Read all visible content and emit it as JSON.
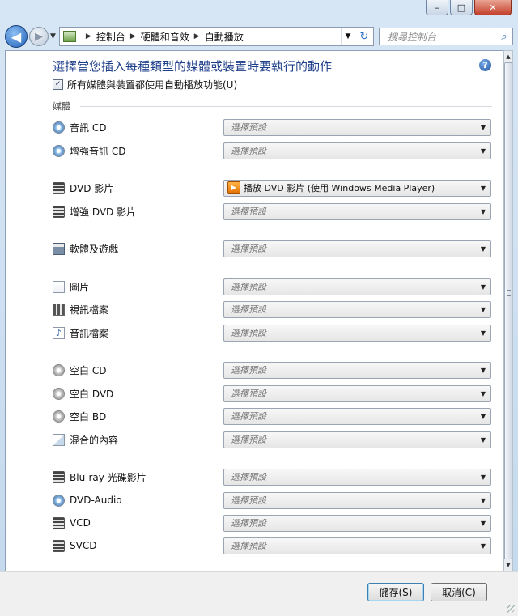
{
  "window": {
    "minimize": "–",
    "maximize": "□",
    "close": "✕"
  },
  "nav": {
    "back_icon": "arrow-left-icon",
    "forward_icon": "arrow-right-icon",
    "breadcrumb": [
      "控制台",
      "硬體和音效",
      "自動播放"
    ],
    "search_placeholder": "搜尋控制台"
  },
  "main": {
    "title": "選擇當您插入每種類型的媒體或裝置時要執行的動作",
    "help": "?",
    "autoplay_label": "所有媒體與裝置都使用自動播放功能(U)",
    "autoplay_checked": true,
    "section_media": "媒體",
    "items": [
      {
        "label": "音訊 CD",
        "icon": "disc-icon",
        "value": "選擇預設"
      },
      {
        "label": "增強音訊 CD",
        "icon": "disc-icon",
        "value": "選擇預設"
      },
      {
        "label": "DVD 影片",
        "icon": "dvd-film-icon",
        "value": "播放 DVD 影片 (使用 Windows Media Player)",
        "selected": true
      },
      {
        "label": "增強 DVD 影片",
        "icon": "dvd-film-icon",
        "value": "選擇預設"
      },
      {
        "label": "軟體及遊戲",
        "icon": "software-icon",
        "value": "選擇預設"
      },
      {
        "label": "圖片",
        "icon": "picture-icon",
        "value": "選擇預設"
      },
      {
        "label": "視訊檔案",
        "icon": "video-file-icon",
        "value": "選擇預設"
      },
      {
        "label": "音訊檔案",
        "icon": "audio-file-icon",
        "value": "選擇預設"
      },
      {
        "label": "空白 CD",
        "icon": "blank-disc-icon",
        "value": "選擇預設"
      },
      {
        "label": "空白 DVD",
        "icon": "blank-disc-icon",
        "value": "選擇預設"
      },
      {
        "label": "空白 BD",
        "icon": "blank-disc-icon",
        "value": "選擇預設"
      },
      {
        "label": "混合的內容",
        "icon": "mixed-content-icon",
        "value": "選擇預設"
      },
      {
        "label": "Blu-ray 光碟影片",
        "icon": "dvd-film-icon",
        "value": "選擇預設"
      },
      {
        "label": "DVD-Audio",
        "icon": "disc-icon",
        "value": "選擇預設"
      },
      {
        "label": "VCD",
        "icon": "dvd-film-icon",
        "value": "選擇預設"
      },
      {
        "label": "SVCD",
        "icon": "dvd-film-icon",
        "value": "選擇預設"
      }
    ]
  },
  "footer": {
    "save": "儲存(S)",
    "cancel": "取消(C)"
  }
}
